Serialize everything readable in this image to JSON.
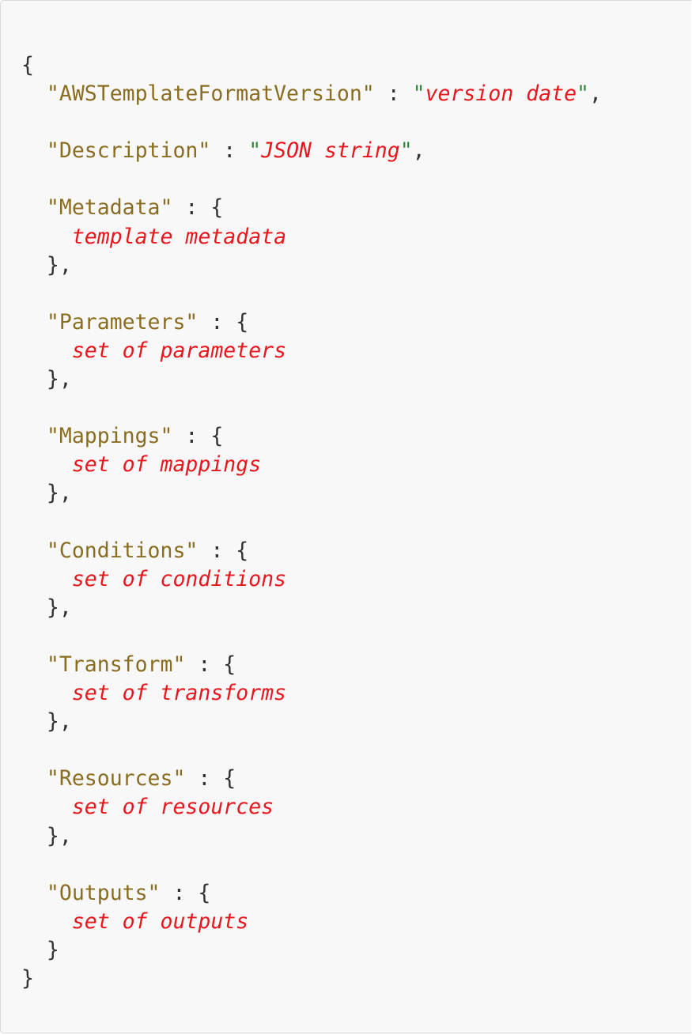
{
  "code": {
    "open_brace": "{",
    "close_brace": "}",
    "version_key": "\"AWSTemplateFormatVersion\"",
    "version_placeholder": "version date",
    "description_key": "\"Description\"",
    "description_placeholder": "JSON string",
    "sections": [
      {
        "key": "\"Metadata\"",
        "placeholder": "template metadata"
      },
      {
        "key": "\"Parameters\"",
        "placeholder": "set of parameters"
      },
      {
        "key": "\"Mappings\"",
        "placeholder": "set of mappings"
      },
      {
        "key": "\"Conditions\"",
        "placeholder": "set of conditions"
      },
      {
        "key": "\"Transform\"",
        "placeholder": "set of transforms"
      },
      {
        "key": "\"Resources\"",
        "placeholder": "set of resources"
      },
      {
        "key": "\"Outputs\"",
        "placeholder": "set of outputs"
      }
    ]
  },
  "colors": {
    "key": "#8a6d1e",
    "placeholder": "#e8171d",
    "string_quote": "#2e8b3a",
    "punctuation": "#333333",
    "background": "#f8f8f8"
  }
}
